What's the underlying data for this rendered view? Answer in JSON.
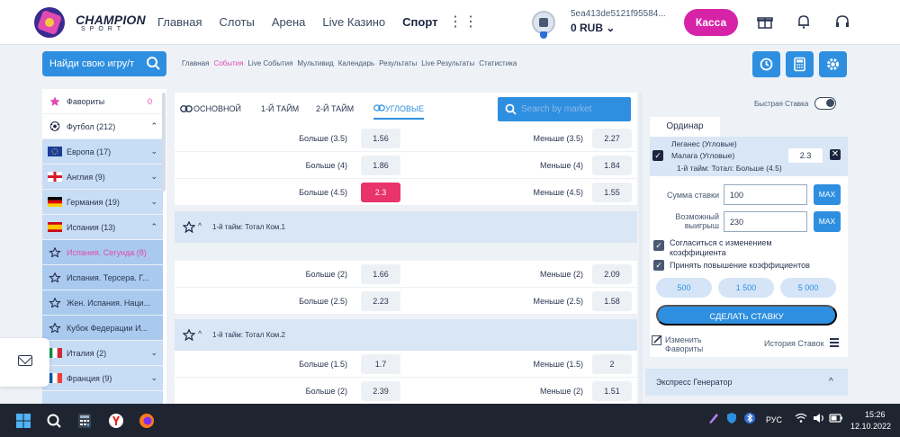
{
  "header": {
    "logo_text": "CHAMPION",
    "logo_sub": "SPORT",
    "nav": [
      "Главная",
      "Слоты",
      "Арена",
      "Live Казино",
      "Спорт"
    ],
    "nav_more": "⋮⋮",
    "account_id": "5ea413de5121f95584...",
    "balance": "0 RUB",
    "kassa_label": "Касса",
    "icons": [
      "gift-icon",
      "bell-icon",
      "headset-icon"
    ]
  },
  "toolbar": {
    "search_game_label": "Найди свою игру/т",
    "subnav": [
      "Главная",
      "События",
      "Live События",
      "Мультивид",
      "Календарь",
      "Результаты",
      "Live Результаты",
      "Статистика"
    ],
    "active_subnav": "События",
    "tool_icons": [
      "history-icon",
      "calculator-icon",
      "settings-icon"
    ]
  },
  "sidebar": {
    "items": [
      {
        "label": "Фавориты",
        "count": "0",
        "icon": "star-icon"
      },
      {
        "label": "Футбол (212)",
        "chevron": "^",
        "icon": "football-icon"
      },
      {
        "label": "Европа (17)",
        "chevron": "v",
        "icon": "flag-eu"
      },
      {
        "label": "Англия (9)",
        "chevron": "v",
        "icon": "flag-england"
      },
      {
        "label": "Германия (19)",
        "chevron": "v",
        "icon": "flag-germany"
      },
      {
        "label": "Испания (13)",
        "chevron": "^",
        "icon": "flag-spain"
      },
      {
        "label": "Испания. Сегунда (8)",
        "icon": "star-icon"
      },
      {
        "label": "Испания. Терсера. Г...",
        "icon": "star-icon"
      },
      {
        "label": "Жен. Испания. Наци...",
        "icon": "star-icon"
      },
      {
        "label": "Кубок Федерации И...",
        "icon": "star-icon"
      },
      {
        "label": "Италия (2)",
        "chevron": "v",
        "icon": "flag-italy"
      },
      {
        "label": "Франция (9)",
        "chevron": "v",
        "icon": "flag-france"
      }
    ]
  },
  "market": {
    "tabs": [
      "ОСНОВНОЙ",
      "1-Й ТАЙМ",
      "2-Й ТАЙМ",
      "УГЛОВЫЕ"
    ],
    "active_tab": "УГЛОВЫЕ",
    "search_placeholder": "Search by market",
    "groups": [
      {
        "title": "",
        "rows": [
          {
            "left_label": "Больше (3.5)",
            "left_odd": "1.56",
            "right_label": "Меньше (3.5)",
            "right_odd": "2.27"
          },
          {
            "left_label": "Больше (4)",
            "left_odd": "1.86",
            "right_label": "Меньше (4)",
            "right_odd": "1.84"
          },
          {
            "left_label": "Больше (4.5)",
            "left_odd": "2.3",
            "right_label": "Меньше (4.5)",
            "right_odd": "1.55",
            "selected": "left"
          }
        ]
      },
      {
        "title": "1-й тайм: Тотал Ком.1",
        "rows": [
          {
            "left_label": "Больше (2)",
            "left_odd": "1.66",
            "right_label": "Меньше (2)",
            "right_odd": "2.09"
          },
          {
            "left_label": "Больше (2.5)",
            "left_odd": "2.23",
            "right_label": "Меньше (2.5)",
            "right_odd": "1.58"
          }
        ]
      },
      {
        "title": "1-й тайм: Тотал Ком.2",
        "rows": [
          {
            "left_label": "Больше (1.5)",
            "left_odd": "1.7",
            "right_label": "Меньше (1.5)",
            "right_odd": "2"
          },
          {
            "left_label": "Больше (2)",
            "left_odd": "2.39",
            "right_label": "Меньше (2)",
            "right_odd": "1.51"
          }
        ]
      }
    ]
  },
  "slip": {
    "fast_bet_label": "Быстрая Ставка",
    "tab_label": "Ординар",
    "bet": {
      "team1": "Леганес (Угловые)",
      "team2": "Малага (Угловые)",
      "market": "1-й тайм: Тотал: Больше (4.5)",
      "odd": "2.3"
    },
    "stake_label": "Сумма ставки",
    "stake_value": "100",
    "win_label_1": "Возможный",
    "win_label_2": "выигрыш",
    "win_value": "230",
    "max_label": "MAX",
    "check1_line1": "Согласиться с изменением",
    "check1_line2": "коэффициента",
    "check2": "Принять повышение коэффициентов",
    "amounts": [
      "500",
      "1 500",
      "5 000"
    ],
    "place_label": "СДЕЛАТЬ СТАВКУ",
    "fav_line1": "Изменить",
    "fav_line2": "Фавориты",
    "history_label": "История Ставок",
    "express_label": "Экспресс Генератор"
  },
  "taskbar": {
    "lang": "РУС",
    "time": "15:26",
    "date": "12.10.2022"
  }
}
